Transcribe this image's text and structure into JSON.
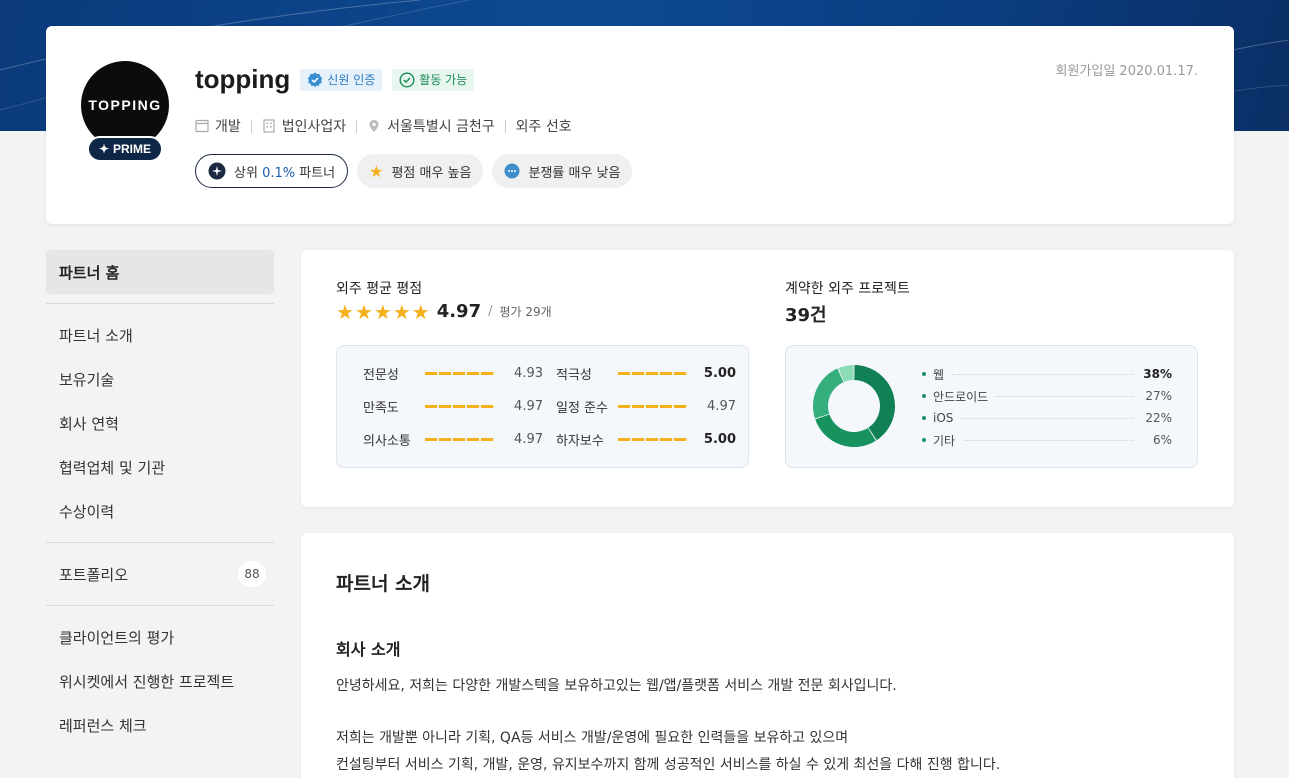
{
  "profile": {
    "avatar_text": "TOPPING",
    "prime_label": "PRIME",
    "name": "topping",
    "verified_label": "신원 인증",
    "available_label": "활동 가능",
    "joined": "회원가입일 2020.01.17.",
    "info": [
      "개발",
      "법인사업자",
      "서울특별시 금천구",
      "외주 선호"
    ],
    "chip_rank_prefix": "상위 ",
    "chip_rank_value": "0.1%",
    "chip_rank_suffix": " 파트너",
    "chip_rating": "평점 매우 높음",
    "chip_dispute": "분쟁률 매우 낮음"
  },
  "sidebar": {
    "items": [
      {
        "label": "파트너 홈"
      },
      {
        "label": "파트너 소개"
      },
      {
        "label": "보유기술"
      },
      {
        "label": "회사 연혁"
      },
      {
        "label": "협력업체 및 기관"
      },
      {
        "label": "수상이력"
      },
      {
        "label": "포트폴리오",
        "count": "88"
      },
      {
        "label": "클라이언트의 평가"
      },
      {
        "label": "위시켓에서 진행한 프로젝트"
      },
      {
        "label": "레퍼런스 체크"
      }
    ]
  },
  "stats": {
    "rating_label": "외주 평균 평점",
    "rating_value": "4.97",
    "rating_count": "평가 29개",
    "rating_stars": 5,
    "projects_label": "계약한 외주 프로젝트",
    "projects_value": "39건",
    "scores": [
      {
        "label": "전문성",
        "value": "4.93"
      },
      {
        "label": "적극성",
        "value": "5.00"
      },
      {
        "label": "만족도",
        "value": "4.97"
      },
      {
        "label": "일정 준수",
        "value": "4.97"
      },
      {
        "label": "의사소통",
        "value": "4.97"
      },
      {
        "label": "하자보수",
        "value": "5.00"
      }
    ]
  },
  "chart_data": {
    "type": "pie",
    "categories": [
      "웹",
      "안드로이드",
      "iOS",
      "기타"
    ],
    "values": [
      38,
      27,
      22,
      6
    ],
    "labels": [
      "38%",
      "27%",
      "22%",
      "6%"
    ],
    "colors": [
      "#118055",
      "#18925f",
      "#34ae7c",
      "#8ddcb8"
    ]
  },
  "intro": {
    "title": "파트너 소개",
    "subtitle": "회사 소개",
    "p1": "안녕하세요, 저희는 다양한 개발스텍을 보유하고있는 웹/앱/플랫폼 서비스 개발 전문 회사입니다.",
    "p2": "저희는 개발뿐 아니라 기획, QA등 서비스 개발/운영에 필요한 인력들을 보유하고 있으며",
    "p3": "컨설팅부터 서비스 기획, 개발, 운영, 유지보수까지 함께 성공적인 서비스를 하실 수 있게 최선을 다해 진행 합니다."
  },
  "colors": {
    "banner": "#0d4a92",
    "star": "#f5b01e",
    "accent": "#1b5fb0",
    "chart_primary": "#118055"
  }
}
